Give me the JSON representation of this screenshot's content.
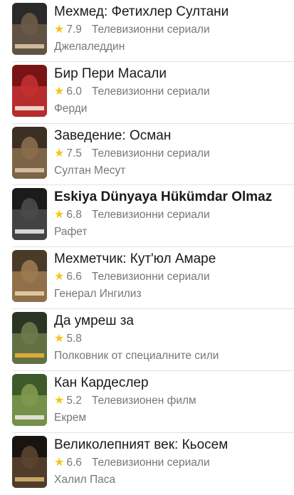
{
  "items": [
    {
      "title": "Мехмед: Фетихлер Султани",
      "rating": "7.9",
      "type": "Телевизионни сериали",
      "role": "Джелаледдин",
      "bold": false,
      "poster_colors": [
        "#2a2a2a",
        "#6b5a48",
        "#d9c7a5"
      ],
      "poster_icon": "poster-mehmed"
    },
    {
      "title": "Бир Пери Масали",
      "rating": "6.0",
      "type": "Телевизионни сериали",
      "role": "Ферди",
      "bold": false,
      "poster_colors": [
        "#7a1414",
        "#c23030",
        "#f1e2d8"
      ],
      "poster_icon": "poster-bir-peri-masali"
    },
    {
      "title": "Заведение: Осман",
      "rating": "7.5",
      "type": "Телевизионни сериали",
      "role": "Султан Месут",
      "bold": false,
      "poster_colors": [
        "#3c2f24",
        "#8a6d4c",
        "#d8c6a8"
      ],
      "poster_icon": "poster-osman"
    },
    {
      "title": "Eskiya Dünyaya Hükümdar Olmaz",
      "rating": "6.8",
      "type": "Телевизионни сериали",
      "role": "Рафет",
      "bold": true,
      "poster_colors": [
        "#1b1b1b",
        "#4a4a4a",
        "#e6e6e6"
      ],
      "poster_icon": "poster-edho"
    },
    {
      "title": "Мехметчик: Кут'юл Амаре",
      "rating": "6.6",
      "type": "Телевизионни сериали",
      "role": "Генерал Ингилиз",
      "bold": false,
      "poster_colors": [
        "#4a3a28",
        "#9c7a50",
        "#e3cfa8"
      ],
      "poster_icon": "poster-mehmetcik"
    },
    {
      "title": "Да умреш за",
      "rating": "5.8",
      "type": "",
      "role": "Полковник от специалните сили",
      "bold": false,
      "poster_colors": [
        "#2c3524",
        "#6d7a4a",
        "#e4b23a"
      ],
      "poster_icon": "poster-da-umresh-za"
    },
    {
      "title": "Кан Кардеслер",
      "rating": "5.2",
      "type": "Телевизионен филм",
      "role": "Екрем",
      "bold": false,
      "poster_colors": [
        "#3f5a2a",
        "#7f9a4e",
        "#ece8e0"
      ],
      "poster_icon": "poster-kan-kardesler"
    },
    {
      "title": "Великолепният век: Кьосем",
      "rating": "6.6",
      "type": "Телевизионни сериали",
      "role": "Халил Паса",
      "bold": false,
      "poster_colors": [
        "#1a1410",
        "#5a4330",
        "#d4b070"
      ],
      "poster_icon": "poster-kosem"
    }
  ]
}
